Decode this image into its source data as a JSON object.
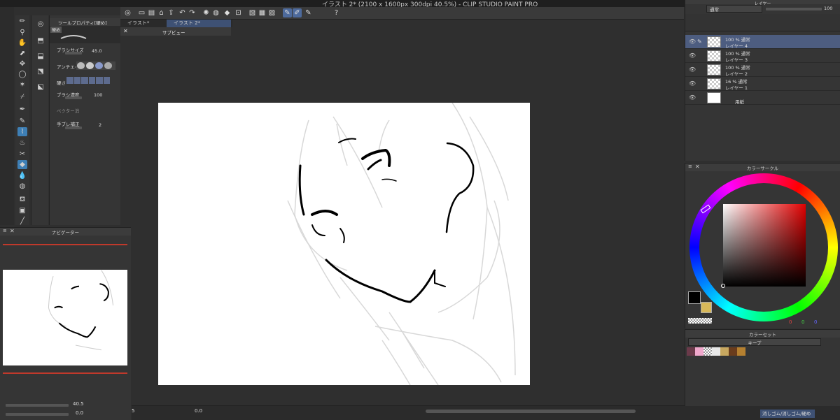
{
  "window": {
    "title": "イラスト 2* (2100 x 1600px 300dpi 40.5%)  - CLIP STUDIO PAINT PRO"
  },
  "document_tabs": [
    {
      "label": "イラスト*",
      "active": false
    },
    {
      "label": "イラスト 2*",
      "active": true
    }
  ],
  "subview": {
    "title": "サブビュー"
  },
  "tool_property": {
    "title": "ツールプロパティ[硬め]",
    "preset": "硬め",
    "brush_size_label": "ブラシサイズ",
    "brush_size_value": "45.0",
    "antialias_label": "アンチエイ",
    "hardness_label": "硬さ",
    "density_label": "ブラシ濃度",
    "density_value": "100",
    "vector_label": "ベクター消",
    "stabilization_label": "手ブレ補正",
    "stabilization_value": "2"
  },
  "navigator": {
    "title": "ナビゲーター",
    "zoom_value": "40.5",
    "rotation_value": "0.0"
  },
  "status": {
    "zoom": "5",
    "angle": "0.0"
  },
  "layer_panel": {
    "title": "レイヤー",
    "blend_mode": "通常",
    "opacity_value": "100",
    "layers": [
      {
        "line1": "100 % 通常",
        "line2": "レイヤー 4",
        "selected": true
      },
      {
        "line1": "100 % 通常",
        "line2": "レイヤー 3",
        "selected": false
      },
      {
        "line1": "100 % 通常",
        "line2": "レイヤー 2",
        "selected": false
      },
      {
        "line1": "16 % 通常",
        "line2": "レイヤー 1",
        "selected": false
      },
      {
        "line1": "",
        "line2": "用紙",
        "selected": false
      }
    ]
  },
  "color_circle": {
    "title": "カラーサークル",
    "r": "0",
    "g": "0",
    "b": "0",
    "main_color": "#000000",
    "sub_color": "#d9b95a"
  },
  "color_set": {
    "title": "カラーセット",
    "set_name": "キープ",
    "swatches": [
      "#6b3a4a",
      "#f0a8cc",
      "#e8e8e8",
      "#c8a860",
      "#6a3c1c",
      "#b58030"
    ]
  },
  "sub_tool": {
    "label": "消しゴム/消しゴム/硬め"
  },
  "colors": {
    "accent": "#4d6a9c",
    "active_tool": "#3e7fb5",
    "panel_bg": "#353535"
  }
}
